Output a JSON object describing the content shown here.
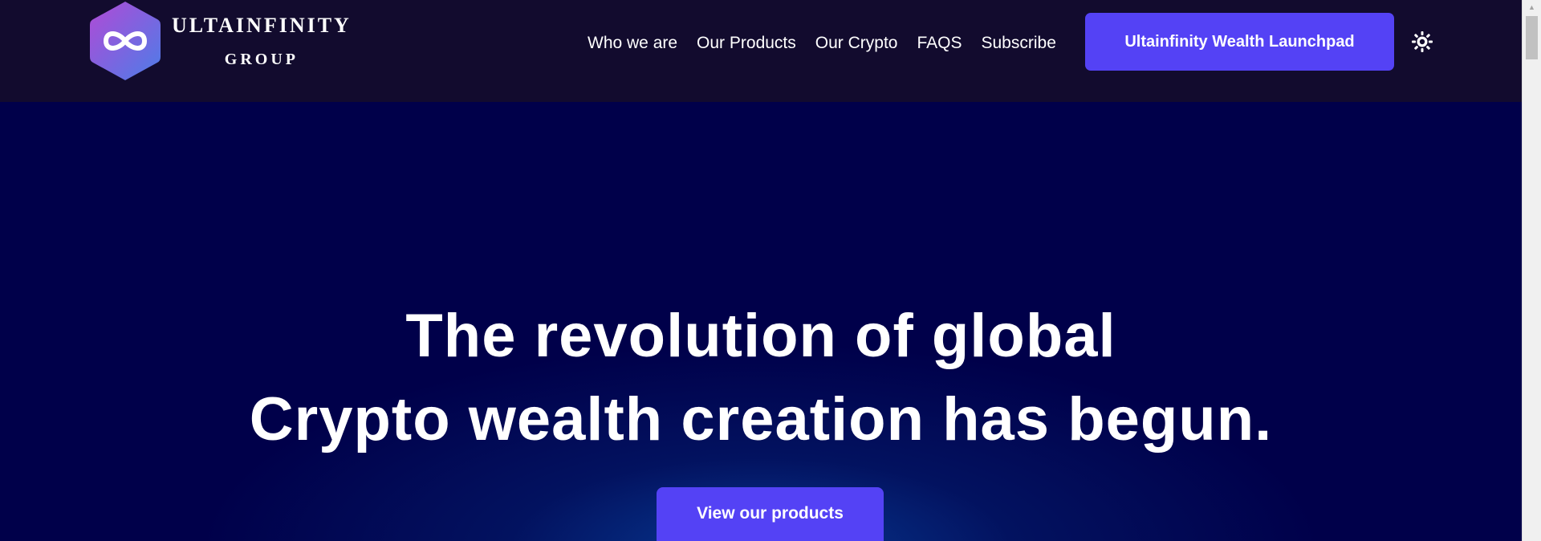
{
  "brand": {
    "line1": "ULTAINFINITY",
    "line2": "GROUP",
    "gradient_from": "#b14ad6",
    "gradient_to": "#4c7de8"
  },
  "nav": {
    "items": [
      {
        "label": "Who we are"
      },
      {
        "label": "Our Products"
      },
      {
        "label": "Our Crypto"
      },
      {
        "label": "FAQS"
      },
      {
        "label": "Subscribe"
      }
    ]
  },
  "header": {
    "cta_label": "Ultainfinity Wealth Launchpad",
    "theme_icon": "sun-icon"
  },
  "hero": {
    "title_line1": "The revolution of global",
    "title_line2": "Crypto wealth creation has begun.",
    "button_label": "View our products"
  },
  "colors": {
    "accent": "#5442f5",
    "header_bg": "#120b2e",
    "hero_bg": "#00004a"
  }
}
